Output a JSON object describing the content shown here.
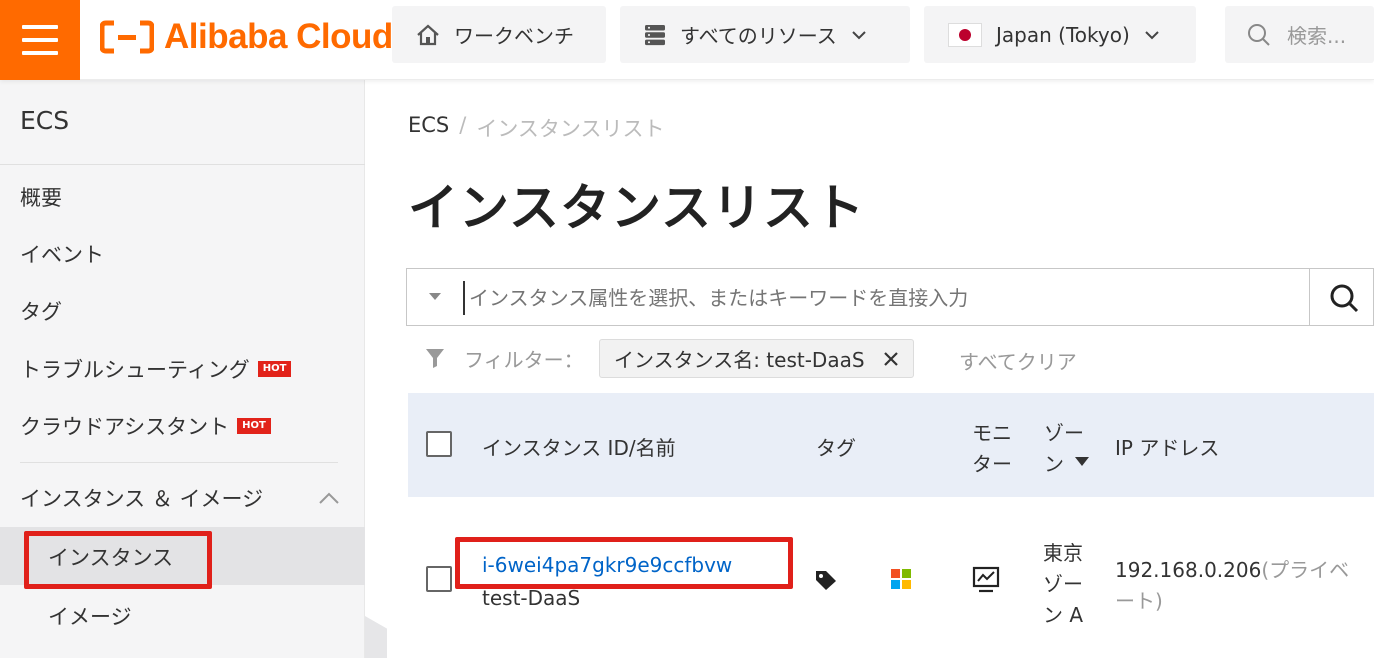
{
  "brand": {
    "name": "Alibaba Cloud",
    "accent_color": "#ff6a00"
  },
  "topbar": {
    "menu_icon": "hamburger-icon",
    "workbench_label": "ワークベンチ",
    "resources_label": "すべてのリソース",
    "region_label": "Japan (Tokyo)",
    "search_placeholder": "検索..."
  },
  "sidebar": {
    "title": "ECS",
    "items": [
      {
        "label": "概要"
      },
      {
        "label": "イベント"
      },
      {
        "label": "タグ"
      },
      {
        "label": "トラブルシューティング",
        "badge": "HOT"
      },
      {
        "label": "クラウドアシスタント",
        "badge": "HOT"
      }
    ],
    "group_label": "インスタンス ＆ イメージ",
    "sub_items": [
      {
        "label": "インスタンス",
        "active": true
      },
      {
        "label": "イメージ"
      }
    ]
  },
  "breadcrumb": {
    "root": "ECS",
    "separator": "/",
    "current": "インスタンスリスト"
  },
  "page_title": "インスタンスリスト",
  "search": {
    "placeholder": "インスタンス属性を選択、またはキーワードを直接入力"
  },
  "filter": {
    "label": "フィルター：",
    "tag": "インスタンス名: test-DaaS",
    "clear_label": "すべてクリア"
  },
  "table": {
    "headers": {
      "id_name": "インスタンス ID/名前",
      "tag": "タグ",
      "monitor_line1": "モニ",
      "monitor_line2": "ター",
      "zone_line1": "ゾー",
      "zone_line2": "ン",
      "ip": "IP アドレス"
    },
    "rows": [
      {
        "id": "i-6wei4pa7gkr9e9ccfbvw",
        "name": "test-DaaS",
        "zone_line1": "東京",
        "zone_line2": "ゾー",
        "zone_line3": "ン A",
        "ip": "192.168.0.206",
        "ip_type_line1": "(プライベ",
        "ip_type_line2": "ート)"
      }
    ]
  }
}
